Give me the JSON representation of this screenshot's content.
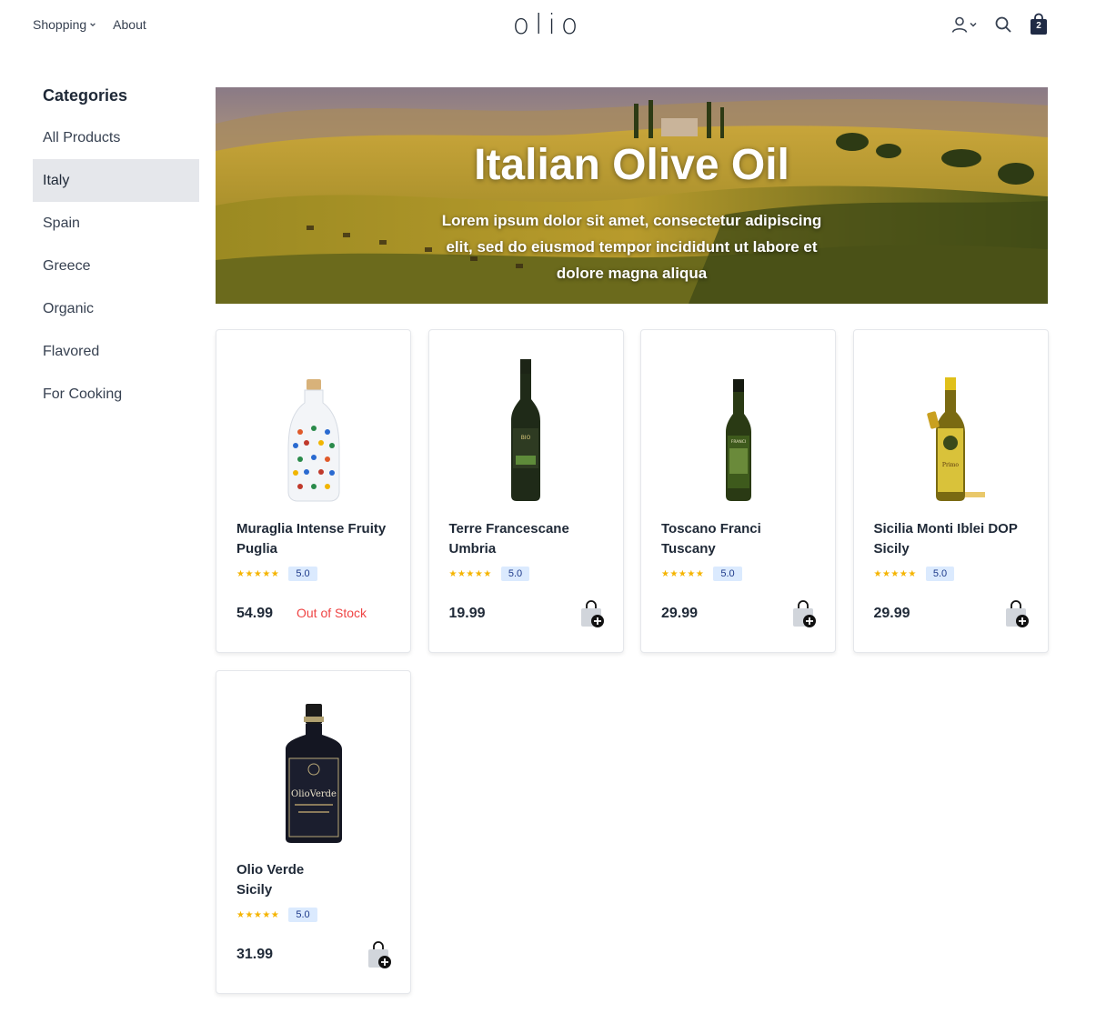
{
  "header": {
    "nav": [
      {
        "label": "Shopping",
        "has_dropdown": true
      },
      {
        "label": "About",
        "has_dropdown": false
      }
    ],
    "logo": "olio",
    "cart_count": "2",
    "icons": [
      "user-icon",
      "chevron-down-icon",
      "search-icon",
      "shopping-bag-icon"
    ]
  },
  "sidebar": {
    "title": "Categories",
    "items": [
      {
        "label": "All Products"
      },
      {
        "label": "Italy",
        "active": true
      },
      {
        "label": "Spain"
      },
      {
        "label": "Greece"
      },
      {
        "label": "Organic"
      },
      {
        "label": "Flavored"
      },
      {
        "label": "For Cooking"
      }
    ]
  },
  "hero": {
    "title": "Italian Olive Oil",
    "subtitle": "Lorem ipsum dolor sit amet, consectetur adipiscing elit, sed do eiusmod tempor incididunt ut labore et dolore magna aliqua"
  },
  "products": [
    {
      "name": "Muraglia Intense Fruity",
      "region": "Puglia",
      "stars": "★★★★★",
      "rating": "5.0",
      "price": "54.99",
      "stock": "Out of Stock"
    },
    {
      "name": "Terre Francescane",
      "region": "Umbria",
      "stars": "★★★★★",
      "rating": "5.0",
      "price": "19.99",
      "stock": ""
    },
    {
      "name": "Toscano Franci",
      "region": "Tuscany",
      "stars": "★★★★★",
      "rating": "5.0",
      "price": "29.99",
      "stock": ""
    },
    {
      "name": "Sicilia Monti Iblei DOP",
      "region": "Sicily",
      "stars": "★★★★★",
      "rating": "5.0",
      "price": "29.99",
      "stock": ""
    },
    {
      "name": "Olio Verde",
      "region": "Sicily",
      "stars": "★★★★★",
      "rating": "5.0",
      "price": "31.99",
      "stock": ""
    }
  ],
  "colors": {
    "accent_dark": "#1f2a44",
    "star": "#f5b400",
    "badge_bg": "#dbeafe",
    "out_of_stock": "#ef4444",
    "active_category_bg": "#e5e7eb"
  }
}
